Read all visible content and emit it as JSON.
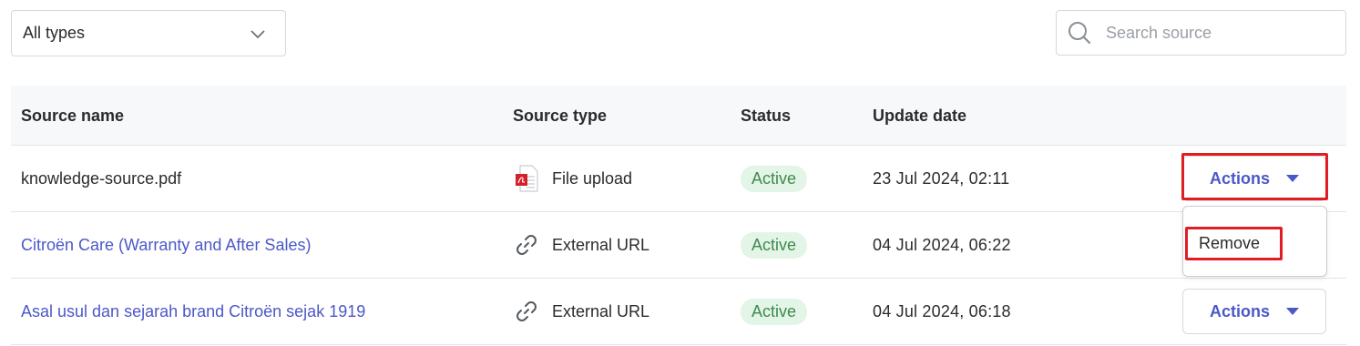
{
  "filter": {
    "selected": "All types",
    "chevron_icon": "chevron-down-icon"
  },
  "search": {
    "placeholder": "Search source",
    "value": "",
    "icon": "search-icon"
  },
  "table": {
    "headers": [
      "Source name",
      "Source type",
      "Status",
      "Update date",
      ""
    ],
    "rows": [
      {
        "name": "knowledge-source.pdf",
        "name_is_link": false,
        "type": "File upload",
        "type_icon": "pdf-file-icon",
        "status": "Active",
        "date": "23 Jul 2024, 02:11",
        "action": "Actions"
      },
      {
        "name": "Citroën Care (Warranty and After Sales)",
        "name_is_link": true,
        "type": "External URL",
        "type_icon": "link-icon",
        "status": "Active",
        "date": "04 Jul 2024, 06:22",
        "action": ""
      },
      {
        "name": "Asal usul dan sejarah brand Citroën sejak 1919",
        "name_is_link": true,
        "type": "External URL",
        "type_icon": "link-icon",
        "status": "Active",
        "date": "04 Jul 2024, 06:18",
        "action": "Actions"
      }
    ]
  },
  "dropdown": {
    "items": [
      "Remove"
    ]
  },
  "colors": {
    "link": "#4b58c8",
    "badge_bg": "#e3f5e6",
    "badge_text": "#3e8a4e",
    "highlight": "#e11d24"
  }
}
